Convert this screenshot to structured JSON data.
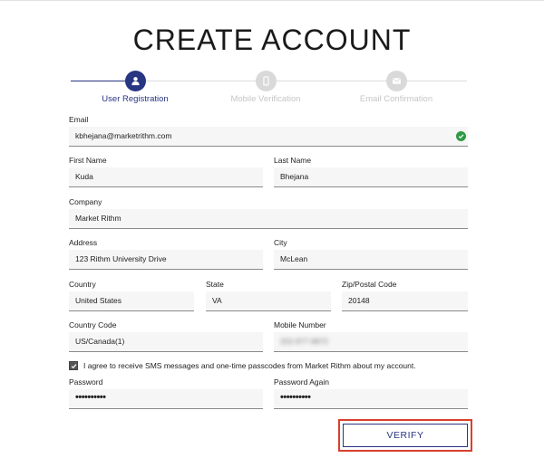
{
  "title": "CREATE ACCOUNT",
  "stepper": {
    "steps": [
      {
        "label": "User Registration",
        "icon": "user-icon",
        "active": true
      },
      {
        "label": "Mobile Verification",
        "icon": "mobile-phone-icon",
        "active": false
      },
      {
        "label": "Email Confirmation",
        "icon": "envelope-icon",
        "active": false
      }
    ]
  },
  "form": {
    "email": {
      "label": "Email",
      "value": "kbhejana@marketrithm.com",
      "status_icon": "check-circle-icon"
    },
    "first_name": {
      "label": "First Name",
      "value": "Kuda"
    },
    "last_name": {
      "label": "Last Name",
      "value": "Bhejana"
    },
    "company": {
      "label": "Company",
      "value": "Market Rithm"
    },
    "address": {
      "label": "Address",
      "value": "123 Rithm University Drive"
    },
    "city": {
      "label": "City",
      "value": "McLean"
    },
    "country": {
      "label": "Country",
      "value": "United States"
    },
    "state": {
      "label": "State",
      "value": "VA"
    },
    "zip": {
      "label": "Zip/Postal Code",
      "value": "20148"
    },
    "country_code": {
      "label": "Country Code",
      "value": "US/Canada(1)"
    },
    "mobile_number": {
      "label": "Mobile Number",
      "value": "202-977-9872"
    },
    "consent": {
      "label": "I agree to receive SMS messages and one-time passcodes from Market Rithm about my account.",
      "checked": true
    },
    "password": {
      "label": "Password",
      "value": "••••••••••"
    },
    "password_again": {
      "label": "Password Again",
      "value": "••••••••••"
    }
  },
  "verify_button": {
    "label": "VERIFY"
  },
  "colors": {
    "primary": "#283582",
    "inactive": "#d9d9d9",
    "success": "#2e9a45",
    "highlight": "#d8412c"
  }
}
